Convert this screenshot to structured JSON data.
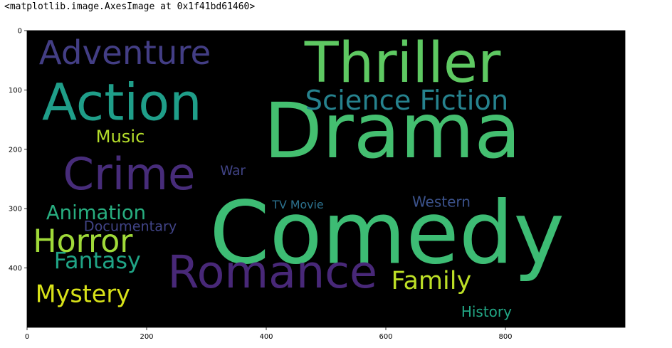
{
  "output_header": "<matplotlib.image.AxesImage at 0x1f41bd61460>",
  "chart_data": {
    "type": "wordcloud",
    "image_width": 1000,
    "image_height": 500,
    "background": "#000000",
    "xlim": [
      0,
      1000
    ],
    "ylim": [
      500,
      0
    ],
    "xticks": [
      0,
      200,
      400,
      600,
      800
    ],
    "yticks": [
      0,
      100,
      200,
      300,
      400
    ],
    "words": [
      {
        "text": "Drama",
        "x": 396,
        "y": 96,
        "size": 128,
        "color": "#44bf70"
      },
      {
        "text": "Comedy",
        "x": 305,
        "y": 257,
        "size": 145,
        "color": "#3dbc74"
      },
      {
        "text": "Thriller",
        "x": 464,
        "y": 0,
        "size": 94,
        "color": "#5ec962"
      },
      {
        "text": "Action",
        "x": 25,
        "y": 70,
        "size": 86,
        "color": "#1f9e89"
      },
      {
        "text": "Romance",
        "x": 235,
        "y": 362,
        "size": 76,
        "color": "#482878"
      },
      {
        "text": "Crime",
        "x": 60,
        "y": 198,
        "size": 75,
        "color": "#472c7a"
      },
      {
        "text": "Adventure",
        "x": 20,
        "y": 6,
        "size": 56,
        "color": "#433e85"
      },
      {
        "text": "Science Fiction",
        "x": 465,
        "y": 91,
        "size": 46,
        "color": "#26828e"
      },
      {
        "text": "Horror",
        "x": 10,
        "y": 325,
        "size": 53,
        "color": "#a0da39"
      },
      {
        "text": "Family",
        "x": 609,
        "y": 398,
        "size": 42,
        "color": "#bddf26"
      },
      {
        "text": "Mystery",
        "x": 14,
        "y": 420,
        "size": 40,
        "color": "#d8e219"
      },
      {
        "text": "Fantasy",
        "x": 45,
        "y": 367,
        "size": 38,
        "color": "#20a486"
      },
      {
        "text": "Animation",
        "x": 32,
        "y": 288,
        "size": 33,
        "color": "#28ae80"
      },
      {
        "text": "Music",
        "x": 115,
        "y": 162,
        "size": 29,
        "color": "#b5de2b"
      },
      {
        "text": "History",
        "x": 726,
        "y": 459,
        "size": 24,
        "color": "#22a785"
      },
      {
        "text": "Western",
        "x": 644,
        "y": 274,
        "size": 24,
        "color": "#3b528b"
      },
      {
        "text": "Documentary",
        "x": 95,
        "y": 316,
        "size": 23,
        "color": "#414487"
      },
      {
        "text": "War",
        "x": 323,
        "y": 224,
        "size": 22,
        "color": "#414487"
      },
      {
        "text": "TV Movie",
        "x": 410,
        "y": 282,
        "size": 19,
        "color": "#2c718e"
      }
    ]
  }
}
